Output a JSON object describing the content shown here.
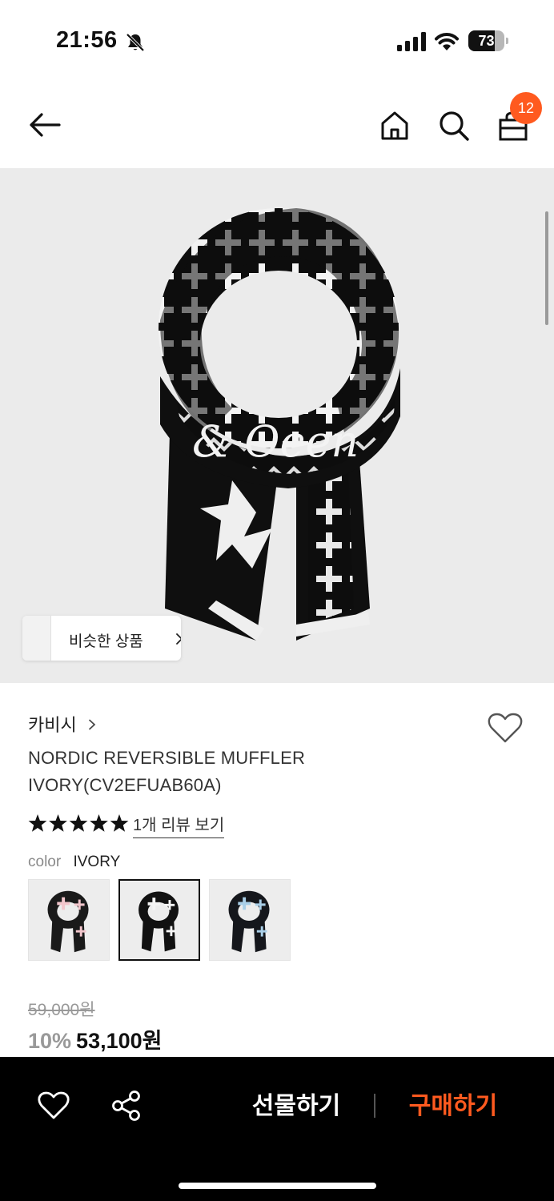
{
  "status_bar": {
    "time": "21:56",
    "battery_level": "73",
    "battery_fraction": 0.73
  },
  "header": {
    "cart_count": "12",
    "accent_color": "#ff5a1f"
  },
  "hero": {
    "similar_products_label": "비슷한 상품"
  },
  "product": {
    "brand": "카비시",
    "title": "NORDIC REVERSIBLE MUFFLER IVORY(CV2EFUAB60A)",
    "rating": 5,
    "review_link": "1개 리뷰 보기",
    "color_label": "color",
    "color_value": "IVORY",
    "swatches": [
      {
        "name": "pink",
        "selected": false
      },
      {
        "name": "ivory",
        "selected": true
      },
      {
        "name": "sky-blue",
        "selected": false
      }
    ],
    "original_price": "59,000원",
    "discount": "10%",
    "price": "53,100원"
  },
  "bottom_bar": {
    "gift_label": "선물하기",
    "buy_label": "구매하기"
  },
  "icons": [
    "bell-off-icon",
    "signal-icon",
    "wifi-icon",
    "back-arrow-icon",
    "home-icon",
    "search-icon",
    "shopping-bag-icon",
    "chevron-right-icon",
    "heart-icon",
    "star-icon",
    "share-icon"
  ]
}
